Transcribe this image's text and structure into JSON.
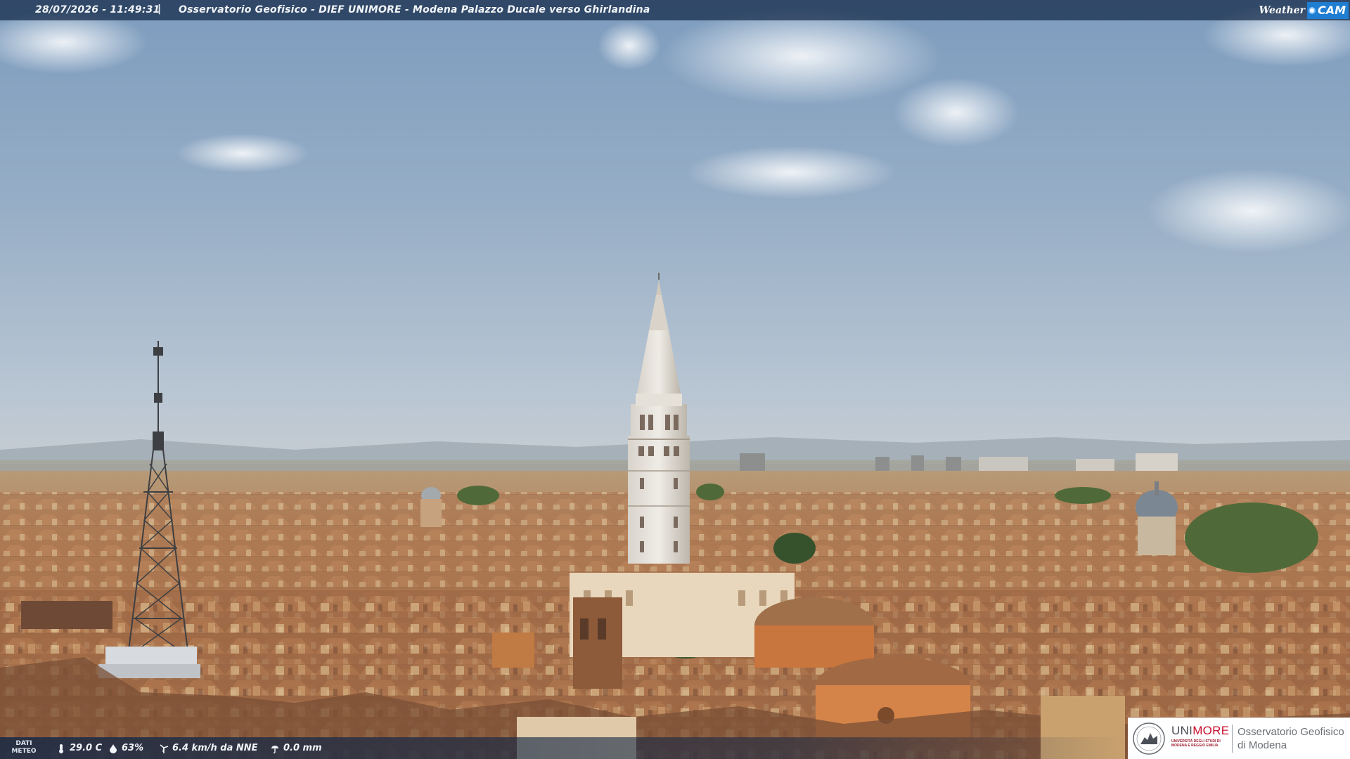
{
  "overlay": {
    "timestamp": "28/07/2026 - 11:49:31",
    "separator": "|",
    "caption": "Osservatorio Geofisico - DIEF UNIMORE - Modena Palazzo Ducale verso Ghirlandina"
  },
  "brand": {
    "weather": "Weather",
    "cam": "CAM",
    "accent": "#1f7ed2"
  },
  "meteo": {
    "label_line1": "DATI",
    "label_line2": "METEO",
    "temperature": "29.0 C",
    "humidity": "63%",
    "wind": "6.4 km/h da NNE",
    "rain": "0.0 mm",
    "icons": [
      "thermometer-icon",
      "humidity-drop-icon",
      "wind-turbine-icon",
      "rain-icon"
    ]
  },
  "logo": {
    "uni_part1": "UNI",
    "uni_part2": "MORE",
    "subtitle": "UNIVERSITÀ DEGLI STUDI DI MODENA E REGGIO EMILIA",
    "observatory_line1": "Osservatorio Geofisico",
    "observatory_line2": "di Modena",
    "brand_red": "#c8102e"
  }
}
